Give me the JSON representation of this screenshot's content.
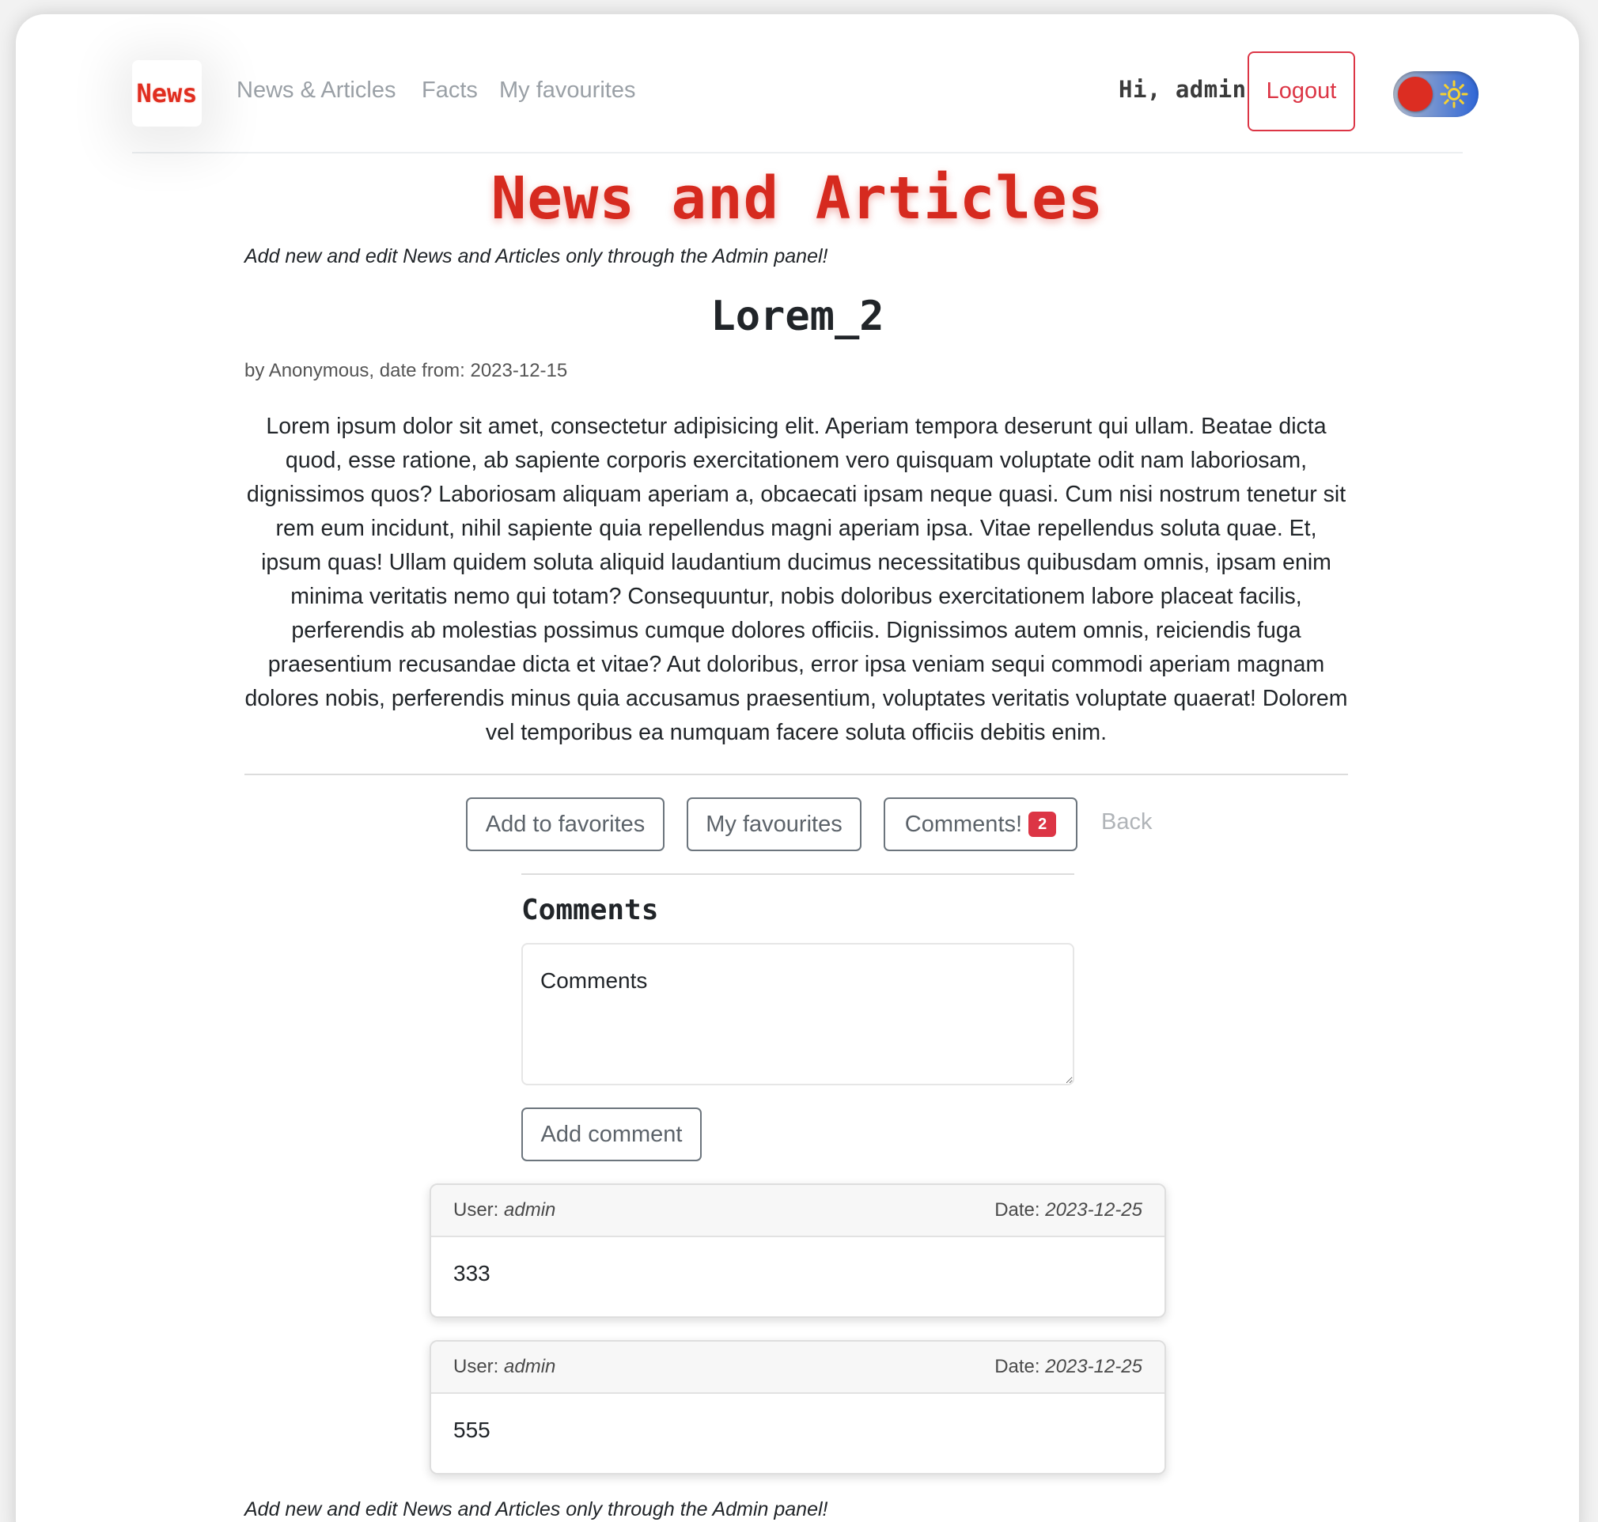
{
  "navbar": {
    "brand": "News",
    "links": [
      "News & Articles",
      "Facts",
      "My favourites"
    ],
    "greeting": "Hi, admin!",
    "logout_label": "Logout",
    "theme_icon": "sun-icon"
  },
  "page": {
    "title": "News and Articles",
    "notice": "Add new and edit News and Articles only through the Admin panel!"
  },
  "article": {
    "title": "Lorem_2",
    "byline": "by Anonymous, date from: 2023-12-15",
    "body": "Lorem ipsum dolor sit amet, consectetur adipisicing elit. Aperiam tempora deserunt qui ullam. Beatae dicta quod, esse ratione, ab sapiente corporis exercitationem vero quisquam voluptate odit nam laboriosam, dignissimos quos? Laboriosam aliquam aperiam a, obcaecati ipsam neque quasi. Cum nisi nostrum tenetur sit rem eum incidunt, nihil sapiente quia repellendus magni aperiam ipsa. Vitae repellendus soluta quae. Et, ipsum quas! Ullam quidem soluta aliquid laudantium ducimus necessitatibus quibusdam omnis, ipsam enim minima veritatis nemo qui totam? Consequuntur, nobis doloribus exercitationem labore placeat facilis, perferendis ab molestias possimus cumque dolores officiis. Dignissimos autem omnis, reiciendis fuga praesentium recusandae dicta et vitae? Aut doloribus, error ipsa veniam sequi commodi aperiam magnam dolores nobis, perferendis minus quia accusamus praesentium, voluptates veritatis voluptate quaerat! Dolorem vel temporibus ea numquam facere soluta officiis debitis enim."
  },
  "actions": {
    "add_favorite": "Add to favorites",
    "my_favourites": "My favourites",
    "comments": "Comments!",
    "comments_count": "2",
    "back": "Back"
  },
  "comments_section": {
    "heading": "Comments",
    "textarea_placeholder": "Comments",
    "add_button": "Add comment",
    "user_label": "User:",
    "date_label": "Date:",
    "items": [
      {
        "user": "admin",
        "date": "2023-12-25",
        "text": "333"
      },
      {
        "user": "admin",
        "date": "2023-12-25",
        "text": "555"
      }
    ]
  },
  "colors": {
    "accent_red": "#d62a1f",
    "danger": "#dc3545",
    "muted": "#9aa0a6"
  }
}
